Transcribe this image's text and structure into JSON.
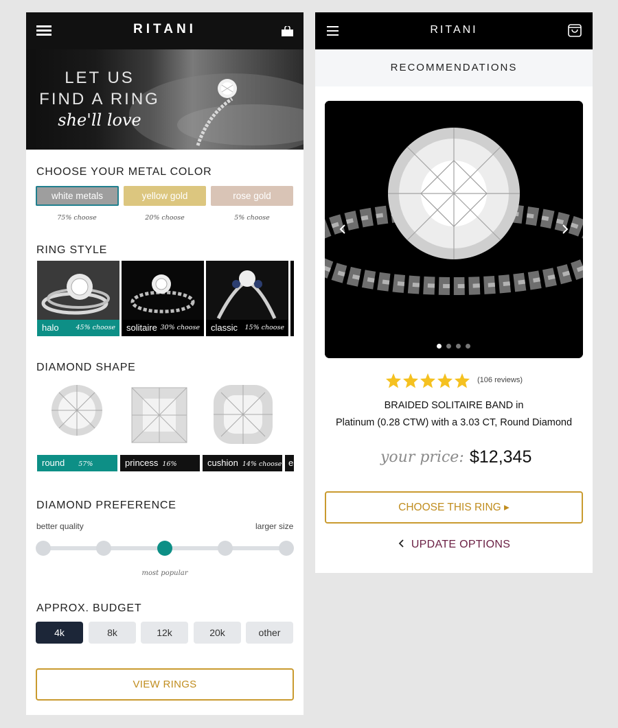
{
  "left": {
    "brand": "RITANI",
    "hero": {
      "line1": "LET US",
      "line2": "FIND A RING",
      "line3": "she'll love"
    },
    "metal": {
      "title": "CHOOSE YOUR METAL COLOR",
      "options": [
        {
          "label": "white metals",
          "pct": "75% choose",
          "color": "#9e9e9e"
        },
        {
          "label": "yellow gold",
          "pct": "20% choose",
          "color": "#dcc67f"
        },
        {
          "label": "rose gold",
          "pct": "5% choose",
          "color": "#d9c4b6"
        }
      ]
    },
    "ring_style": {
      "title": "RING STYLE",
      "options": [
        {
          "label": "halo",
          "pct": "45% choose"
        },
        {
          "label": "solitaire",
          "pct": "30% choose"
        },
        {
          "label": "classic",
          "pct": "15% choose"
        }
      ]
    },
    "diamond_shape": {
      "title": "DIAMOND SHAPE",
      "options": [
        {
          "label": "round",
          "pct": "57% choose"
        },
        {
          "label": "princess",
          "pct": "16% choose"
        },
        {
          "label": "cushion",
          "pct": "14% choose"
        },
        {
          "label": "e",
          "pct": ""
        }
      ]
    },
    "preference": {
      "title": "DIAMOND PREFERENCE",
      "left_label": "better quality",
      "right_label": "larger size",
      "note": "most popular",
      "selected_index": 2,
      "steps": 5
    },
    "budget": {
      "title": "APPROX. BUDGET",
      "options": [
        "4k",
        "8k",
        "12k",
        "20k",
        "other"
      ],
      "selected": "4k"
    },
    "cta": "VIEW RINGS"
  },
  "right": {
    "brand": "RITANI",
    "header": "RECOMMENDATIONS",
    "carousel": {
      "slides": 4,
      "active": 1
    },
    "rating": {
      "stars": 5,
      "reviews": "(106 reviews)"
    },
    "product": {
      "line1": "BRAIDED SOLITAIRE BAND in",
      "line2": "Platinum (0.28 CTW) with a 3.03 CT, Round Diamond"
    },
    "price_label": "your price:",
    "price": "$12,345",
    "cta": "CHOOSE THIS RING ▸",
    "back": "UPDATE OPTIONS"
  },
  "colors": {
    "teal": "#0d8f86",
    "gold": "#c99a2e",
    "navy": "#1c2638",
    "plum": "#6b2044",
    "star": "#f5c120"
  }
}
